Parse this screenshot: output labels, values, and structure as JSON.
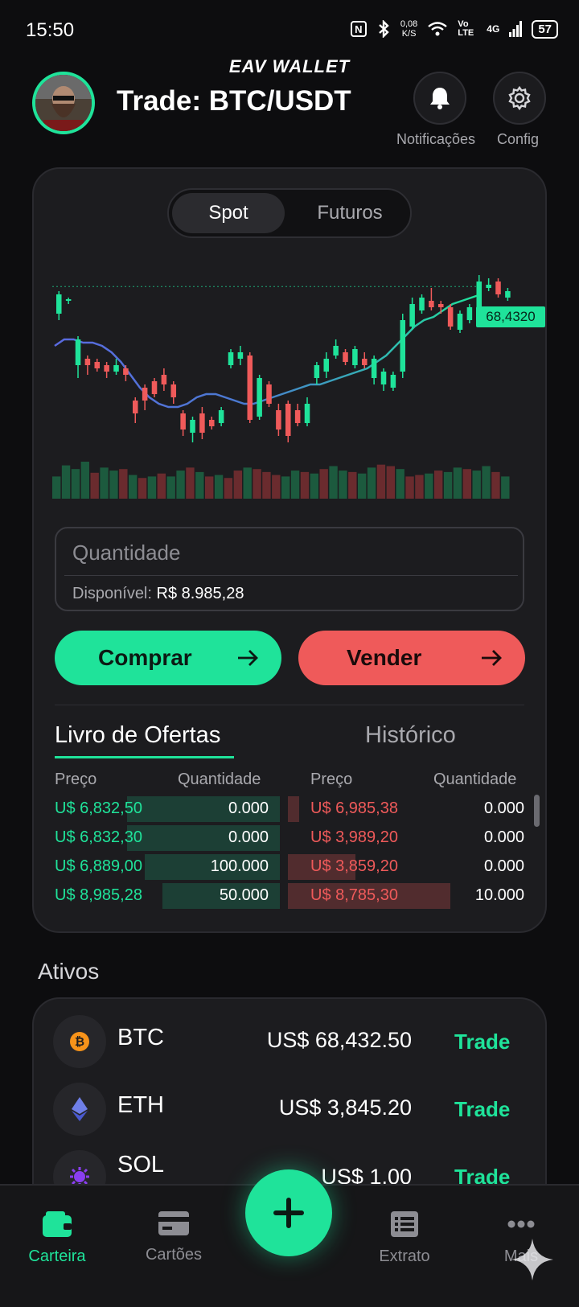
{
  "status_bar": {
    "time": "15:50",
    "net_speed_value": "0,08",
    "net_speed_unit": "K/S",
    "signal_label": "Vo LTE",
    "network": "4G",
    "battery": "57"
  },
  "header": {
    "brand": "EAV WALLET",
    "title": "Trade: BTC/USDT",
    "notifications_label": "Notificações",
    "config_label": "Config"
  },
  "segmented": {
    "spot": "Spot",
    "futures": "Futuros",
    "selected": "Spot"
  },
  "chart": {
    "current_price_label": "68,4320"
  },
  "chart_data": {
    "type": "candlestick",
    "last_price": 68.432,
    "ma_color": "#5a6ae0",
    "up_color": "#1fe39a",
    "down_color": "#ef5a5a",
    "candles": [
      {
        "o": 60,
        "c": 66,
        "h": 67,
        "l": 58
      },
      {
        "o": 64,
        "c": 64.5,
        "h": 65,
        "l": 63
      },
      {
        "o": 44,
        "c": 52,
        "h": 53,
        "l": 40
      },
      {
        "o": 46,
        "c": 44,
        "h": 47,
        "l": 41
      },
      {
        "o": 45,
        "c": 43,
        "h": 46,
        "l": 42
      },
      {
        "o": 44,
        "c": 42,
        "h": 45,
        "l": 40
      },
      {
        "o": 42,
        "c": 44,
        "h": 46,
        "l": 41
      },
      {
        "o": 43,
        "c": 41,
        "h": 44,
        "l": 39
      },
      {
        "o": 33,
        "c": 29,
        "h": 34,
        "l": 26
      },
      {
        "o": 37,
        "c": 33,
        "h": 38,
        "l": 30
      },
      {
        "o": 39,
        "c": 35,
        "h": 40,
        "l": 34
      },
      {
        "o": 41,
        "c": 38,
        "h": 43,
        "l": 36
      },
      {
        "o": 38,
        "c": 34,
        "h": 39,
        "l": 32
      },
      {
        "o": 29,
        "c": 24,
        "h": 30,
        "l": 22
      },
      {
        "o": 23,
        "c": 27,
        "h": 28,
        "l": 20
      },
      {
        "o": 29,
        "c": 23,
        "h": 31,
        "l": 21
      },
      {
        "o": 27,
        "c": 25,
        "h": 28,
        "l": 24
      },
      {
        "o": 26,
        "c": 30,
        "h": 31,
        "l": 25
      },
      {
        "o": 44,
        "c": 48,
        "h": 49,
        "l": 43
      },
      {
        "o": 46,
        "c": 48,
        "h": 50,
        "l": 44
      },
      {
        "o": 47,
        "c": 27,
        "h": 48,
        "l": 26
      },
      {
        "o": 28,
        "c": 40,
        "h": 41,
        "l": 27
      },
      {
        "o": 38,
        "c": 32,
        "h": 39,
        "l": 31
      },
      {
        "o": 30,
        "c": 24,
        "h": 32,
        "l": 22
      },
      {
        "o": 32,
        "c": 22,
        "h": 33,
        "l": 20
      },
      {
        "o": 30,
        "c": 26,
        "h": 32,
        "l": 25
      },
      {
        "o": 26,
        "c": 32,
        "h": 34,
        "l": 25
      },
      {
        "o": 40,
        "c": 44,
        "h": 45,
        "l": 38
      },
      {
        "o": 42,
        "c": 46,
        "h": 48,
        "l": 40
      },
      {
        "o": 47,
        "c": 50,
        "h": 52,
        "l": 46
      },
      {
        "o": 48,
        "c": 45,
        "h": 49,
        "l": 44
      },
      {
        "o": 44,
        "c": 49,
        "h": 50,
        "l": 43
      },
      {
        "o": 46,
        "c": 44,
        "h": 48,
        "l": 43
      },
      {
        "o": 40,
        "c": 46,
        "h": 47,
        "l": 38
      },
      {
        "o": 38,
        "c": 42,
        "h": 43,
        "l": 36
      },
      {
        "o": 37,
        "c": 41,
        "h": 42,
        "l": 36
      },
      {
        "o": 42,
        "c": 58,
        "h": 60,
        "l": 40
      },
      {
        "o": 56,
        "c": 63,
        "h": 65,
        "l": 55
      },
      {
        "o": 61,
        "c": 65,
        "h": 66,
        "l": 60
      },
      {
        "o": 64,
        "c": 62,
        "h": 68,
        "l": 61
      },
      {
        "o": 63,
        "c": 62,
        "h": 64,
        "l": 60
      },
      {
        "o": 62,
        "c": 56,
        "h": 63,
        "l": 55
      },
      {
        "o": 55,
        "c": 60,
        "h": 61,
        "l": 54
      },
      {
        "o": 58,
        "c": 62,
        "h": 63,
        "l": 57
      },
      {
        "o": 61,
        "c": 70,
        "h": 72,
        "l": 60
      },
      {
        "o": 68,
        "c": 69,
        "h": 71,
        "l": 67
      },
      {
        "o": 70,
        "c": 66,
        "h": 71,
        "l": 65
      },
      {
        "o": 65,
        "c": 67,
        "h": 68,
        "l": 64
      }
    ],
    "moving_average": [
      50,
      52,
      52,
      51,
      51,
      50,
      48,
      45,
      41,
      37,
      34,
      32,
      31,
      31,
      32,
      34,
      35,
      35,
      34,
      33,
      32,
      32,
      33,
      34,
      35,
      36,
      37,
      38,
      38,
      39,
      40,
      41,
      42,
      43,
      45,
      47,
      50,
      53,
      56,
      58,
      59,
      61,
      63,
      64,
      65,
      66
    ],
    "volume": [
      30,
      45,
      40,
      50,
      35,
      42,
      38,
      40,
      32,
      28,
      30,
      34,
      30,
      38,
      42,
      36,
      30,
      32,
      28,
      38,
      42,
      40,
      36,
      32,
      30,
      38,
      36,
      34,
      40,
      44,
      38,
      36,
      34,
      42,
      46,
      44,
      40,
      30,
      32,
      34,
      38,
      36,
      42,
      40,
      38,
      44,
      36,
      30
    ],
    "volume_up": [
      true,
      true,
      true,
      true,
      false,
      true,
      true,
      false,
      true,
      false,
      true,
      false,
      true,
      true,
      false,
      true,
      false,
      true,
      false,
      false,
      true,
      false,
      false,
      false,
      true,
      true,
      false,
      true,
      false,
      true,
      true,
      false,
      true,
      true,
      false,
      false,
      true,
      false,
      false,
      true,
      false,
      true,
      true,
      false,
      true,
      true,
      false,
      true
    ]
  },
  "quantity": {
    "placeholder": "Quantidade",
    "available_label": "Disponível:",
    "available_value": "R$ 8.985,28"
  },
  "actions": {
    "buy": "Comprar",
    "sell": "Vender"
  },
  "book_tabs": {
    "book": "Livro de Ofertas",
    "history": "Histórico"
  },
  "order_book": {
    "headers": {
      "price": "Preço",
      "quantity": "Quantidade"
    },
    "bids": [
      {
        "price": "U$ 6,832,50",
        "qty": "0.000",
        "depth": 0.68
      },
      {
        "price": "U$ 6,832,30",
        "qty": "0.000",
        "depth": 0.68
      },
      {
        "price": "U$ 6,889,00",
        "qty": "100.000",
        "depth": 0.6
      },
      {
        "price": "U$ 8,985,28",
        "qty": "50.000",
        "depth": 0.52
      }
    ],
    "asks": [
      {
        "price": "U$ 6,985,38",
        "qty": "0.000",
        "depth": 0.05
      },
      {
        "price": "U$ 3,989,20",
        "qty": "0.000",
        "depth": 0.0
      },
      {
        "price": "U$ 3,859,20",
        "qty": "0.000",
        "depth": 0.3
      },
      {
        "price": "U$ 8,785,30",
        "qty": "10.000",
        "depth": 0.72
      }
    ]
  },
  "assets": {
    "title": "Ativos",
    "items": [
      {
        "symbol": "BTC",
        "price": "US$ 68,432.50",
        "action": "Trade"
      },
      {
        "symbol": "ETH",
        "price": "US$ 3,845.20",
        "action": "Trade"
      },
      {
        "symbol": "SOL",
        "price": "US$ 1.00",
        "action": "Trade"
      }
    ]
  },
  "bottom_nav": {
    "wallet": "Carteira",
    "cards": "Cartões",
    "statement": "Extrato",
    "more": "Mais",
    "active": "Carteira"
  }
}
